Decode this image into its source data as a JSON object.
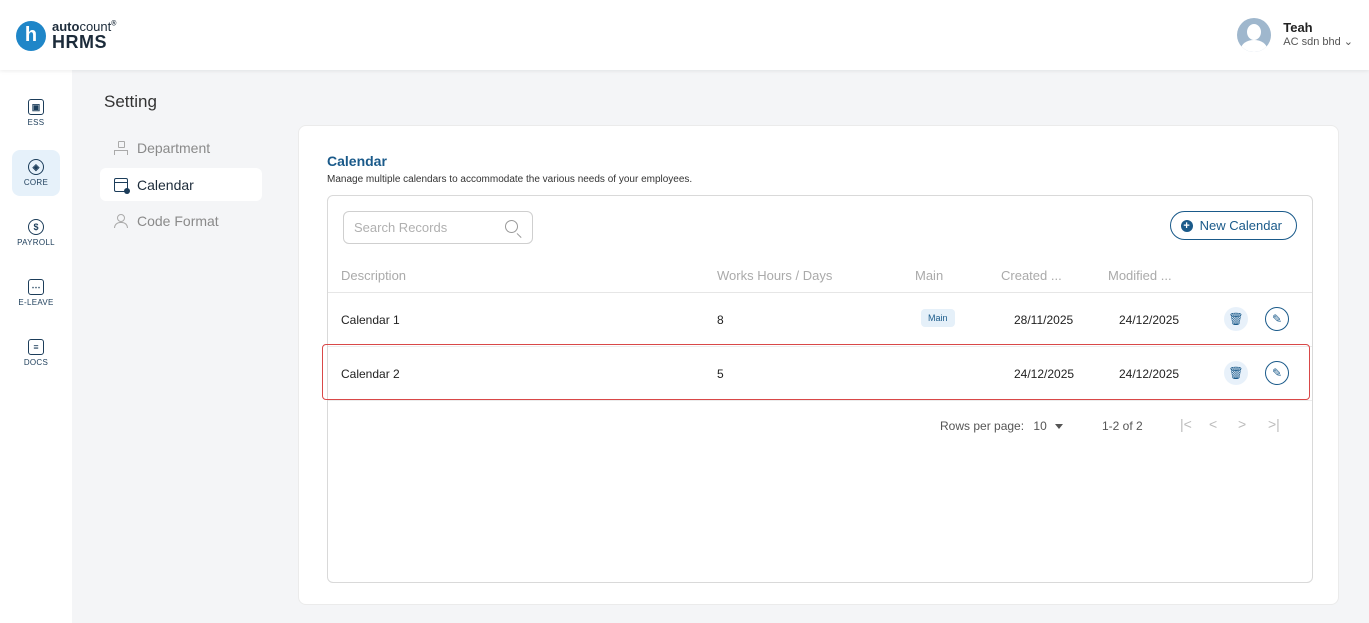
{
  "app": {
    "brand_top": "auto",
    "brand_top_light": "count",
    "brand_mark": "®",
    "brand_bottom": "HRMS",
    "logo_letter": "h"
  },
  "user": {
    "name": "Teah",
    "company": "AC sdn bhd",
    "dropdown_icon": "chevron-down-icon"
  },
  "rail": [
    {
      "label": "ESS",
      "icon": "ess-icon",
      "glyph": "👤"
    },
    {
      "label": "CORE",
      "icon": "core-icon",
      "glyph": "◈"
    },
    {
      "label": "PAYROLL",
      "icon": "payroll-icon",
      "glyph": "$"
    },
    {
      "label": "E-LEAVE",
      "icon": "eleave-icon",
      "glyph": "⋯"
    },
    {
      "label": "DOCS",
      "icon": "docs-icon",
      "glyph": "≡"
    }
  ],
  "page": {
    "title": "Setting"
  },
  "settings_nav": [
    {
      "label": "Department"
    },
    {
      "label": "Calendar"
    },
    {
      "label": "Code Format"
    }
  ],
  "card": {
    "title": "Calendar",
    "subtitle": "Manage multiple calendars to accommodate the various needs of your employees."
  },
  "search": {
    "placeholder": "Search Records",
    "value": ""
  },
  "new_button": {
    "label": "New Calendar"
  },
  "table": {
    "columns": [
      "Description",
      "Works Hours / Days",
      "Main",
      "Created ...",
      "Modified ..."
    ],
    "rows": [
      {
        "description": "Calendar 1",
        "hours": "8",
        "main": "Main",
        "created": "28/11/2025",
        "modified": "24/12/2025"
      },
      {
        "description": "Calendar 2",
        "hours": "5",
        "main": "",
        "created": "24/12/2025",
        "modified": "24/12/2025"
      }
    ]
  },
  "pagination": {
    "rows_label": "Rows per page:",
    "rows_value": "10",
    "range": "1-2 of 2",
    "first": "|<",
    "prev": "<",
    "next": ">",
    "last": ">|"
  },
  "colors": {
    "accent": "#1a5a8a",
    "highlight": "#d94848"
  }
}
